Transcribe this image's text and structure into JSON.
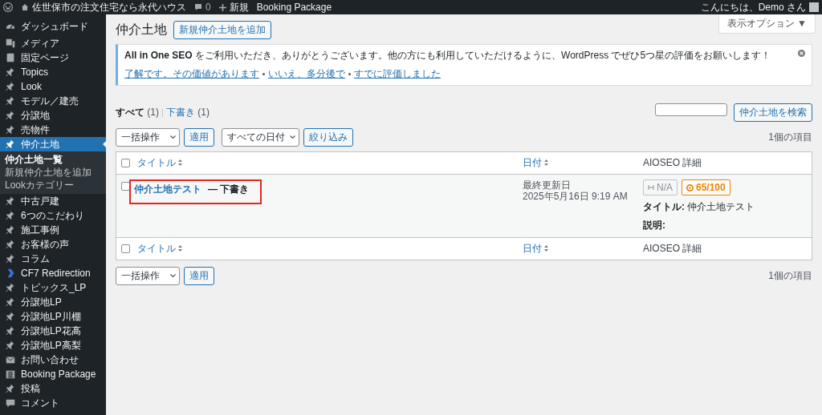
{
  "admin_bar": {
    "site_name": "佐世保市の注文住宅なら永代ハウス",
    "comments_count": "0",
    "new_label": "新規",
    "plugin_link": "Booking Package",
    "greeting": "こんにちは、Demo さん"
  },
  "sidebar": {
    "items": [
      {
        "label": "ダッシュボード",
        "kind": "dashboard",
        "selected": false
      },
      {
        "label": "メディア",
        "kind": "media",
        "selected": false
      },
      {
        "label": "固定ページ",
        "kind": "page",
        "selected": false
      },
      {
        "label": "Topics",
        "kind": "pin",
        "selected": false
      },
      {
        "label": "Look",
        "kind": "pin",
        "selected": false
      },
      {
        "label": "モデル／建売",
        "kind": "pin",
        "selected": false
      },
      {
        "label": "分譲地",
        "kind": "pin",
        "selected": false
      },
      {
        "label": "売物件",
        "kind": "pin",
        "selected": false
      },
      {
        "label": "仲介土地",
        "kind": "pin",
        "selected": true,
        "children": [
          {
            "label": "仲介土地一覧",
            "selected": true
          },
          {
            "label": "新規仲介土地を追加",
            "selected": false
          },
          {
            "label": "Lookカテゴリー",
            "selected": false
          }
        ]
      },
      {
        "label": "中古戸建",
        "kind": "pin",
        "selected": false
      },
      {
        "label": "6つのこだわり",
        "kind": "pin",
        "selected": false
      },
      {
        "label": "施工事例",
        "kind": "pin",
        "selected": false
      },
      {
        "label": "お客様の声",
        "kind": "pin",
        "selected": false
      },
      {
        "label": "コラム",
        "kind": "pin",
        "selected": false
      },
      {
        "label": "CF7 Redirection",
        "kind": "chevron",
        "selected": false
      },
      {
        "label": "トピックス_LP",
        "kind": "pin",
        "selected": false
      },
      {
        "label": "分譲地LP",
        "kind": "pin",
        "selected": false
      },
      {
        "label": "分譲地LP川棚",
        "kind": "pin",
        "selected": false
      },
      {
        "label": "分譲地LP花高",
        "kind": "pin",
        "selected": false
      },
      {
        "label": "分譲地LP高梨",
        "kind": "pin",
        "selected": false
      },
      {
        "label": "お問い合わせ",
        "kind": "mail",
        "selected": false
      },
      {
        "label": "Booking Package",
        "kind": "calendar",
        "selected": false
      },
      {
        "label": "投稿",
        "kind": "pin",
        "selected": false
      },
      {
        "label": "コメント",
        "kind": "comment",
        "selected": false
      }
    ]
  },
  "screen_options": "表示オプション ▼",
  "page_title": "仲介土地",
  "add_new_button": "新規仲介土地を追加",
  "notice": {
    "message": "**All in One SEO** をご利用いただき、ありがとうございます。他の方にも利用していただけるように、WordPress でぜひ5つ星の評価をお願いします！",
    "links": [
      "了解です。その価値があります",
      "いいえ、多分後で",
      "すでに評価しました"
    ]
  },
  "filters": [
    {
      "label": "すべて",
      "count": "(1)",
      "selected": true
    },
    {
      "label": "下書き",
      "count": "(1)",
      "selected": false
    }
  ],
  "search_button": "仲介土地を検索",
  "bulk_action": "一括操作",
  "apply_button": "適用",
  "date_filter": "すべての日付",
  "filter_button": "絞り込み",
  "items_count": "1個の項目",
  "table": {
    "columns": [
      "タイトル",
      "日付",
      "AIOSEO 詳細"
    ],
    "header_checked": false,
    "footer_columns": [
      "タイトル",
      "日付",
      "AIOSEO 詳細"
    ],
    "footer_checked": false,
    "rows": [
      {
        "checked": false,
        "title": "仲介土地テスト",
        "status": "— 下書き",
        "highlighted": true,
        "date_label": "最終更新日",
        "date": "2025年5月16日 9:19 AM",
        "seo_badges": [
          "N/A",
          "65/100"
        ],
        "seo_title_label": "タイトル:",
        "seo_title": "仲介土地テスト",
        "seo_description_label": "説明:"
      }
    ]
  },
  "bottom_bulk_action": "一括操作",
  "bottom_apply_button": "適用",
  "bottom_items_count": "1個の項目"
}
